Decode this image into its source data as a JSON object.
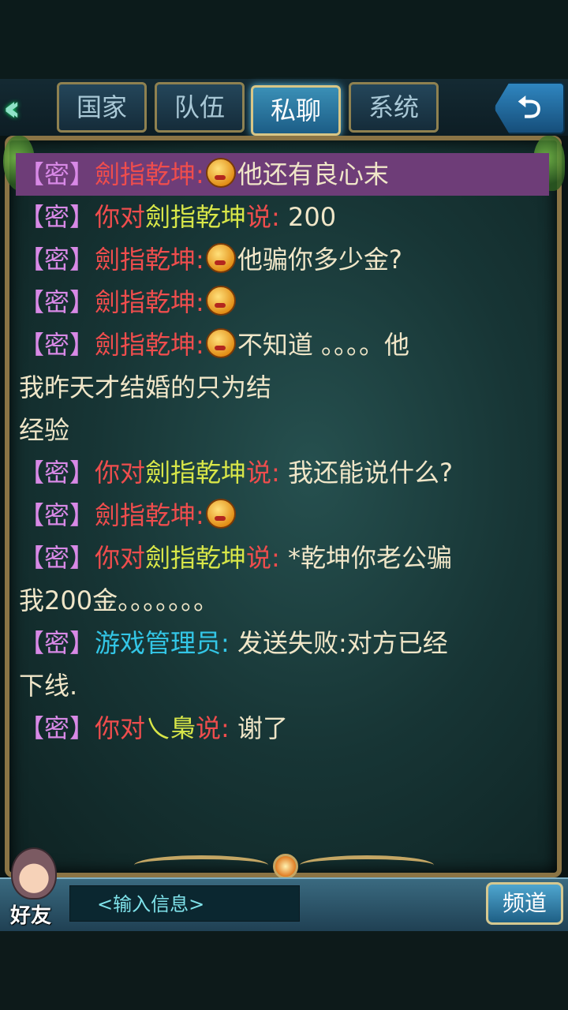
{
  "tabs": [
    {
      "label": "国家",
      "active": false
    },
    {
      "label": "队伍",
      "active": false
    },
    {
      "label": "私聊",
      "active": true
    },
    {
      "label": "系统",
      "active": false
    }
  ],
  "messages": [
    {
      "tag": "【密】",
      "speaker": "劍指乾坤:",
      "emoji": true,
      "text": "他还有良心末",
      "highlight": true
    },
    {
      "tag": "【密】",
      "prefix": "你对",
      "target": "劍指乾坤",
      "suffix": "说:",
      "text": " 200"
    },
    {
      "tag": "【密】",
      "speaker": "劍指乾坤:",
      "emoji": true,
      "text": "他骗你多少金?"
    },
    {
      "tag": "【密】",
      "speaker": "劍指乾坤:",
      "emoji": true,
      "text": ""
    },
    {
      "tag": "【密】",
      "speaker": "劍指乾坤:",
      "emoji": true,
      "text": "不知道 。。。。他我昨天才结婚的只为结经验",
      "line2": "我昨天才结婚的只为结",
      "line3": "经验"
    },
    {
      "tag": "【密】",
      "prefix": "你对",
      "target": "劍指乾坤",
      "suffix": "说:",
      "text": " 我还能说什么?"
    },
    {
      "tag": "【密】",
      "speaker": "劍指乾坤:",
      "emoji": true,
      "text": ""
    },
    {
      "tag": "【密】",
      "prefix": "你对",
      "target": "劍指乾坤",
      "suffix": "说:",
      "text": " *乾坤你老公骗",
      "line2": "我200金。。。。。。。"
    },
    {
      "tag": "【密】",
      "speaker": "游戏管理员:",
      "speaker_color": "cyan",
      "text": " 发送失败:对方已经",
      "line2": "下线."
    },
    {
      "tag": "【密】",
      "prefix": "你对",
      "target": "乀梟",
      "suffix": "说:",
      "text": " 谢了"
    }
  ],
  "bottom": {
    "friend_label": "好友",
    "input_placeholder": "<输入信息>",
    "channel_label": "频道"
  },
  "icons": {
    "back": "double-chevron-left-icon",
    "return": "return-arrow-icon",
    "emoji": "smiley-face-icon"
  },
  "colors": {
    "tag": "#d889e6",
    "speaker": "#ef4d4d",
    "target": "#d8e648",
    "admin": "#33c6e6",
    "text": "#f0e6c8",
    "highlight": "#6e3d78"
  }
}
